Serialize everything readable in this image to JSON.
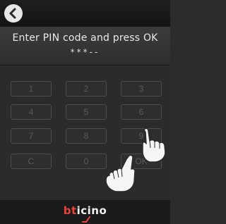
{
  "header": {
    "back_icon": "back-arrow-icon"
  },
  "prompt": {
    "title": "Enter PIN code and press OK",
    "pin_display": "***--"
  },
  "keypad": {
    "keys": [
      "1",
      "2",
      "3",
      "4",
      "5",
      "6",
      "7",
      "8",
      "9",
      "C",
      "0",
      "OK"
    ]
  },
  "overlay": {
    "hand_icon": "pointing-hand-icon"
  },
  "footer": {
    "brand_prefix": "bt",
    "brand_suffix": "icino"
  },
  "colors": {
    "brand_accent": "#e8443a",
    "background": "#2c2c2c"
  }
}
